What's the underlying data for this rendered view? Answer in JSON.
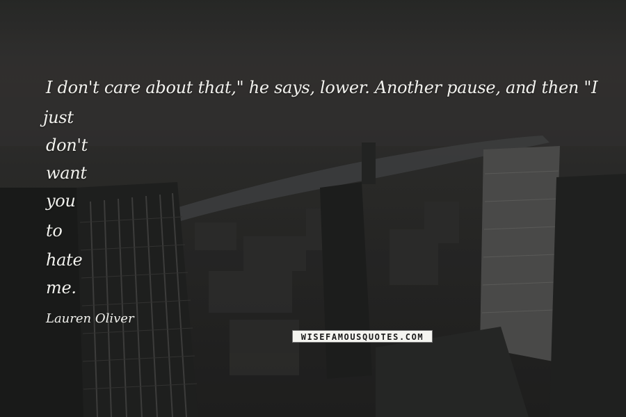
{
  "quote": {
    "lines": [
      "I don't care about that,\" he says, lower. Another pause, and then \"I",
      "just",
      "don't",
      "want",
      "you",
      "to",
      "hate",
      "me."
    ]
  },
  "author": "Lauren Oliver",
  "watermark": "WISEFAMOUSQUOTES.COM",
  "colors": {
    "text": "#f2f2ee",
    "background": "#2e2e2c"
  }
}
